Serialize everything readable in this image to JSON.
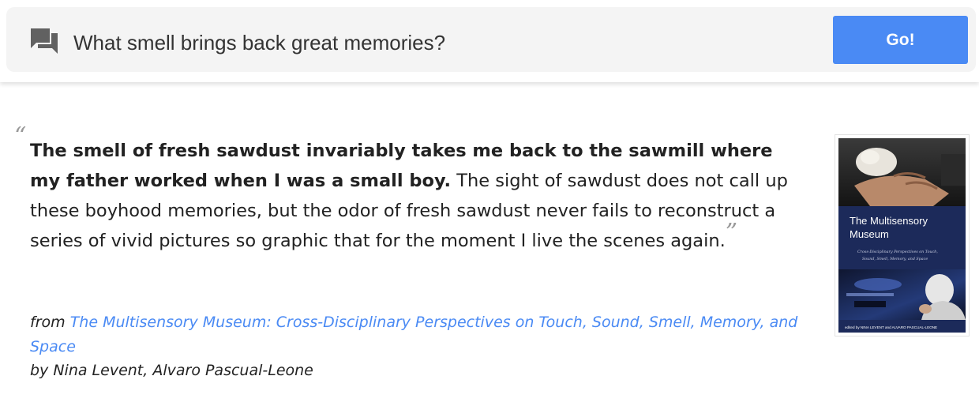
{
  "search": {
    "icon": "chat-bubbles-icon",
    "question": "What smell brings back great memories?",
    "go_label": "Go!"
  },
  "quote": {
    "open_mark": "“",
    "bold_text": "The smell of fresh sawdust invariably takes me back to the sawmill where my father worked when I was a small boy.",
    "rest_text": " The sight of sawdust does not call up these boyhood memories, but the odor of fresh sawdust never fails to reconstruct a series of vivid pictures so graphic that for the moment I live the scenes again.",
    "close_mark": "”"
  },
  "attribution": {
    "from_label": "from ",
    "book_title": "The Multisensory Museum: Cross-Disciplinary Perspectives on Touch, Sound, Smell, Memory, and Space",
    "by_line": "by Nina Levent, Alvaro Pascual-Leone"
  },
  "cover": {
    "title_line1": "The Multisensory",
    "title_line2": "Museum",
    "subtitle_line1": "Cross-Disciplinary Perspectives on Touch,",
    "subtitle_line2": "Sound, Smell, Memory, and Space",
    "editors": "edited by NINA LEVENT and ALVARO PASCUAL-LEONE",
    "colors": {
      "band": "#1c2a5a",
      "photo_top": "#2d2d2d",
      "photo_bottom": "#1a2440"
    }
  },
  "colors": {
    "accent": "#4a8af4",
    "search_bg": "#f4f4f4",
    "quote_marks": "#999999"
  }
}
